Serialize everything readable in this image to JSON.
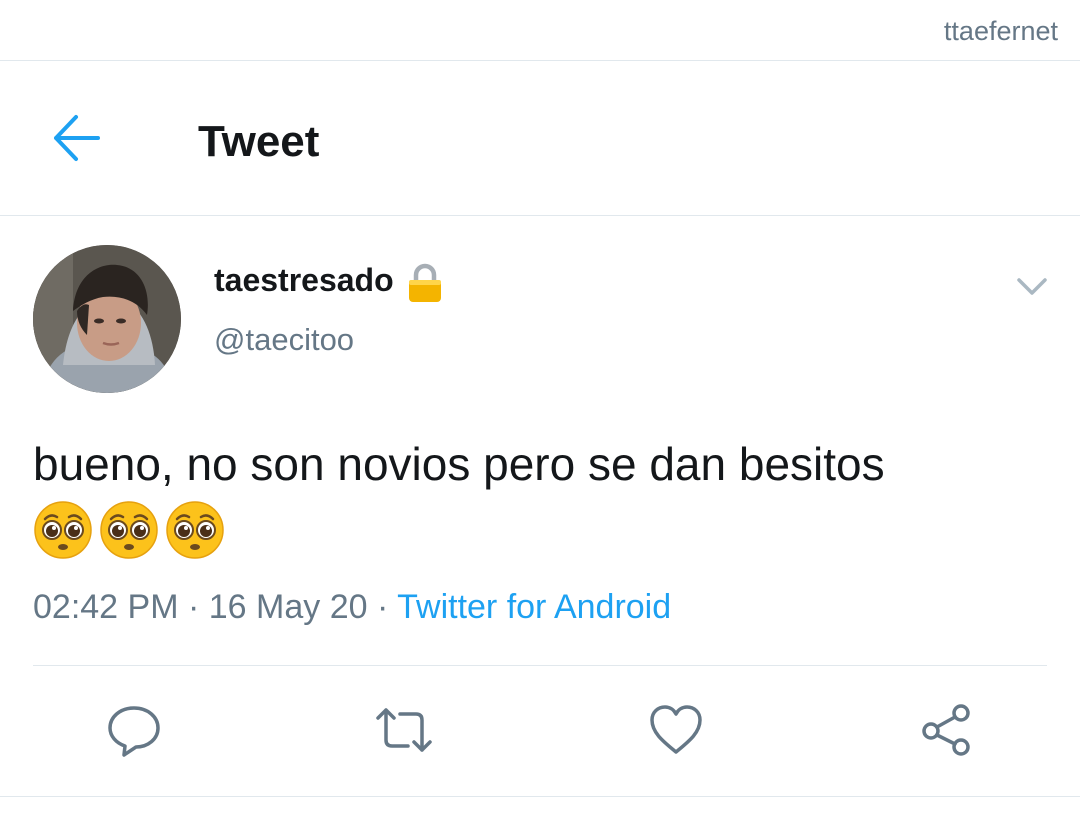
{
  "watermark": "ttaefernet",
  "header": {
    "title": "Tweet",
    "back_icon": "arrow-left-icon"
  },
  "tweet": {
    "display_name": "taestresado",
    "protected_icon": "lock-icon",
    "handle": "@taecitoo",
    "text": "bueno, no son novios pero se dan besitos",
    "emojis": [
      "pleading-face",
      "pleading-face",
      "pleading-face"
    ],
    "time": "02:42 PM",
    "date": "16 May 20",
    "source": "Twitter for Android",
    "meta_separator": " · "
  },
  "actions": [
    "reply-icon",
    "retweet-icon",
    "like-icon",
    "share-icon"
  ],
  "colors": {
    "accent": "#1da1f2",
    "secondary_text": "#657786",
    "divider": "#e1e8ed",
    "primary_text": "#14171a"
  }
}
